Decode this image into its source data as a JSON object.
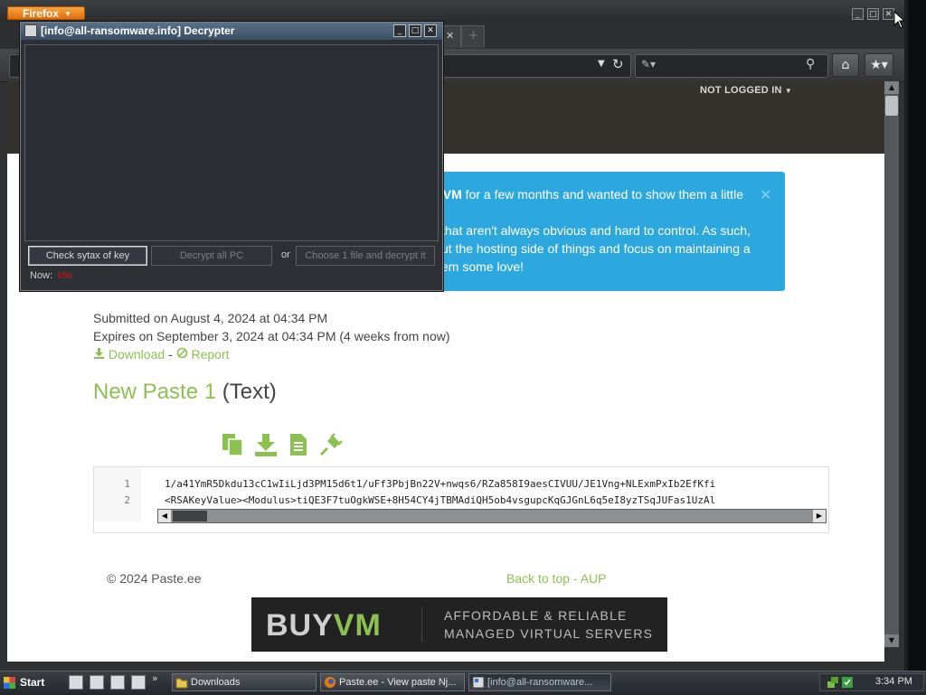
{
  "firefox": {
    "menu_button": "Firefox",
    "page_status": "NOT LOGGED IN"
  },
  "notice": {
    "line1_bold": "yVM",
    "line1": " for a few months and wanted to show them a little",
    "line2": "that aren't always obvious and hard to control. As such,",
    "line3": "ut the hosting side of things and focus on maintaining a",
    "line4": "em some love!"
  },
  "paste": {
    "submitted": "Submitted on August 4, 2024 at 04:34 PM",
    "expires": "Expires on September 3, 2024 at 04:34 PM (4 weeks from now)",
    "download_label": "Download",
    "report_label": "Report",
    "sep": "-",
    "title": "New Paste 1",
    "type": "(Text)",
    "lines": [
      {
        "no": "1",
        "text": "1/a41YmR5Dkdu13cC1wIiLjd3PM15d6t1/uFf3PbjBn22V+nwqs6/RZa858I9aesCIVUU/JE1Vng+NLExmPxIb2EfKfi"
      },
      {
        "no": "2",
        "text": "<RSAKeyValue><Modulus>tiQE3F7tuOgkWSE+8H54CY4jTBMAdiQH5ob4vsgupcKqGJGnL6q5eI8yzTSqJUFas1UzAl"
      }
    ]
  },
  "footer": {
    "copyright": "© 2024 Paste.ee",
    "back_to_top": "Back to top",
    "sep": "-",
    "aup": "AUP"
  },
  "banner": {
    "logo_buy": "BUY",
    "logo_vm": "VM",
    "tagline1": "AFFORDABLE & RELIABLE",
    "tagline2": "MANAGED VIRTUAL SERVERS"
  },
  "decrypter": {
    "title": "[info@all-ransomware.info] Decrypter",
    "check_button": "Check sytax of key",
    "decrypt_all_button": "Decrypt all PC",
    "or": "or",
    "choose_file_button": "Choose 1 file and decrypt it",
    "status_label": "Now:",
    "status_value": "Idle"
  },
  "taskbar": {
    "start": "Start",
    "more": "»",
    "items": [
      {
        "label": "Downloads"
      },
      {
        "label": "Paste.ee - View paste Nj..."
      },
      {
        "label": "[info@all-ransomware..."
      }
    ],
    "clock": "3:34 PM"
  },
  "icons": {
    "copy": "copy-icon",
    "download": "download-icon",
    "raw": "document-icon",
    "embed": "plug-icon"
  },
  "colors": {
    "accent_green": "#8cc152",
    "notice_blue": "#2da8df",
    "firefox_orange": "#e8790f",
    "status_red": "#c01818"
  }
}
